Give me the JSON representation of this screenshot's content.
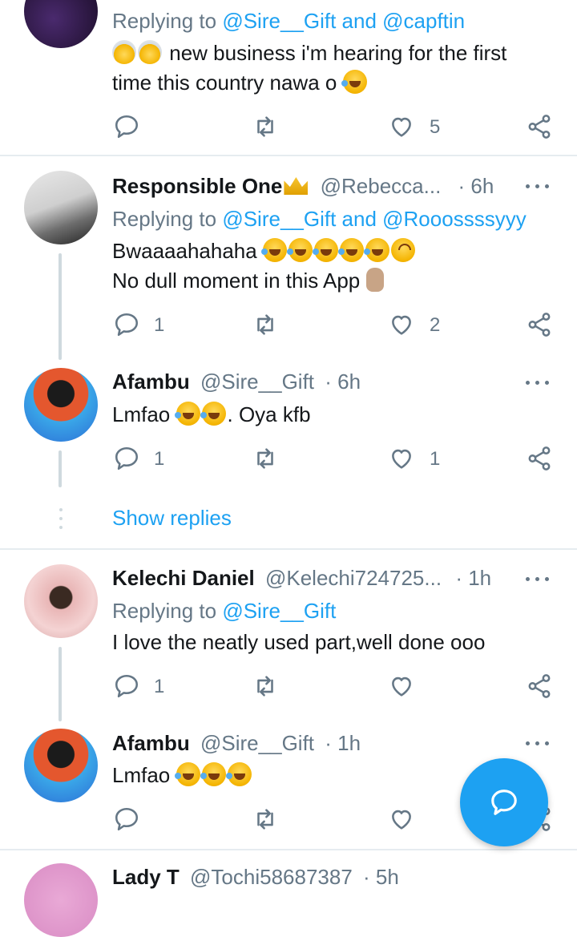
{
  "tweets": [
    {
      "reply_to_prefix": "Replying to ",
      "reply_to_mention_1": "@Sire__Gift",
      "reply_to_and": " and ",
      "reply_to_mention_2": "@capftin",
      "line1": "new business i'm hearing for the first",
      "line2": "time this country nawa o",
      "reply_count": "",
      "like_count": "5"
    },
    {
      "name": "Responsible One",
      "handle": "@Rebecca...",
      "time": "· 6h",
      "reply_to_prefix": "Replying to ",
      "reply_to_mention_1": "@Sire__Gift",
      "reply_to_and": " and ",
      "reply_to_mention_2": "@Rooossssyyy",
      "line1": "Bwaaaahahaha",
      "line2": "No dull moment in this App",
      "reply_count": "1",
      "like_count": "2"
    },
    {
      "name": "Afambu",
      "handle": "@Sire__Gift",
      "time": "· 6h",
      "line1_a": "Lmfao",
      "line1_b": ". Oya kfb",
      "reply_count": "1",
      "like_count": "1"
    },
    {
      "name": "Kelechi Daniel",
      "handle": "@Kelechi724725...",
      "time": "· 1h",
      "reply_to_prefix": "Replying to ",
      "reply_to_mention_1": "@Sire__Gift",
      "line1": "I love the neatly used part,well done ooo",
      "reply_count": "1",
      "like_count": ""
    },
    {
      "name": "Afambu",
      "handle": "@Sire__Gift",
      "time": "· 1h",
      "line1": "Lmfao",
      "reply_count": "",
      "like_count": ""
    },
    {
      "name": "Lady T",
      "handle": "@Tochi58687387",
      "time": "· 5h"
    }
  ],
  "show_replies": "Show replies",
  "colors": {
    "accent": "#1da1f2",
    "muted": "#657786",
    "text": "#14171a",
    "divider": "#e6ecf0"
  },
  "icons": {
    "reply": "reply-icon",
    "retweet": "retweet-icon",
    "like": "like-icon",
    "share": "share-icon",
    "compose": "compose-reply-icon",
    "more": "more-icon"
  }
}
